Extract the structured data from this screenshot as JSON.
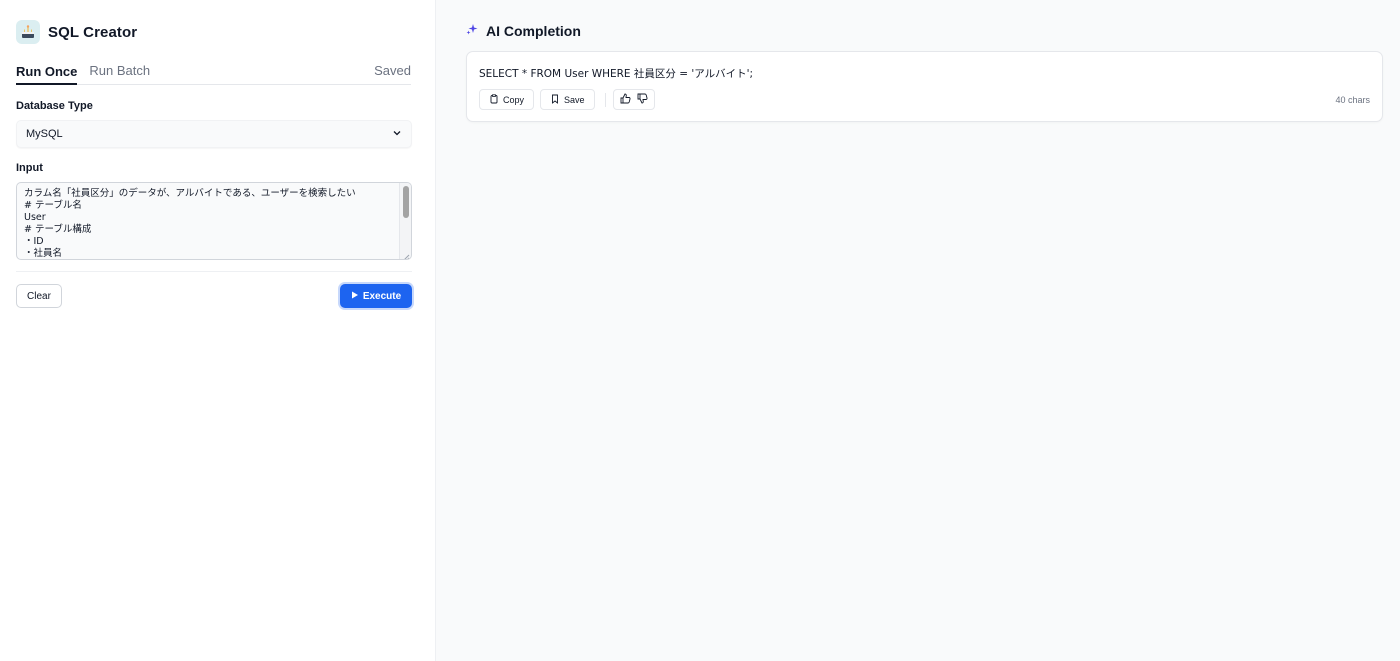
{
  "app": {
    "title": "SQL Creator",
    "icon": "cake-icon"
  },
  "tabs": [
    {
      "label": "Run Once",
      "active": true
    },
    {
      "label": "Run Batch",
      "active": false
    }
  ],
  "saved_label": "Saved",
  "database": {
    "label": "Database Type",
    "value": "MySQL"
  },
  "input": {
    "label": "Input",
    "value": "カラム名「社員区分」のデータが、アルバイトである、ユーザーを検索したい\n# テーブル名\nUser\n# テーブル構成\n・ID\n・社員名"
  },
  "buttons": {
    "clear": "Clear",
    "execute": "Execute"
  },
  "completion": {
    "title": "AI Completion",
    "text": "SELECT * FROM User WHERE 社員区分 = 'アルバイト';",
    "copy_label": "Copy",
    "save_label": "Save",
    "char_count": "40 chars"
  },
  "colors": {
    "accent": "#1d64f0",
    "sparkle": "#4f46e5"
  }
}
